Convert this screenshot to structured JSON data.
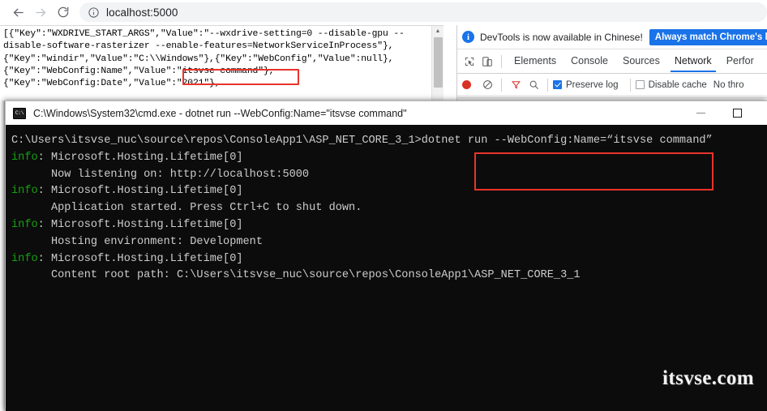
{
  "browser": {
    "toolbar": {
      "back_icon": "back-arrow-icon",
      "forward_icon": "forward-arrow-icon",
      "reload_icon": "reload-icon",
      "site_info_icon": "info-circle-icon",
      "url": "localhost:5000"
    },
    "page": {
      "lines": [
        "[{\"Key\":\"WXDRIVE_START_ARGS\",\"Value\":\"--wxdrive-setting=0 --disable-gpu --",
        "disable-software-rasterizer --enable-features=NetworkServiceInProcess\"},",
        "{\"Key\":\"windir\",\"Value\":\"C:\\\\Windows\"},{\"Key\":\"WebConfig\",\"Value\":null},",
        "{\"Key\":\"WebConfig:Name\",\"Value\":\"itsvse command\"},",
        "{\"Key\":\"WebConfig:Date\",\"Value\":\"2021\"},"
      ],
      "scrollbar": {
        "up_arrow_icon": "scroll-up-arrow-icon",
        "thumb": "scrollbar-thumb"
      }
    }
  },
  "devtools": {
    "banner": {
      "info_icon": "info-badge-icon",
      "info_glyph": "i",
      "message": "DevTools is now available in Chinese!",
      "action_label": "Always match Chrome's lang"
    },
    "tabbar": {
      "inspect_icon": "inspect-element-icon",
      "device_toggle_icon": "device-toolbar-icon",
      "tabs": [
        {
          "label": "Elements",
          "active": false
        },
        {
          "label": "Console",
          "active": false
        },
        {
          "label": "Sources",
          "active": false
        },
        {
          "label": "Network",
          "active": true
        },
        {
          "label": "Perfor",
          "active": false
        }
      ]
    },
    "toolbar": {
      "record_icon": "record-button-icon",
      "clear_icon": "clear-network-log-icon",
      "filter_icon": "filter-funnel-icon",
      "search_icon": "search-magnifier-icon",
      "preserve_log_label": "Preserve log",
      "preserve_log_checked": true,
      "disable_cache_label": "Disable cache",
      "disable_cache_checked": false,
      "throttling_label": "No thro"
    }
  },
  "cmd_window": {
    "icon_name": "cmd-console-icon",
    "icon_glyph": "C:\\",
    "title": "C:\\Windows\\System32\\cmd.exe - dotnet  run --WebConfig:Name=\"itsvse command\"",
    "minimize_label": "minimize-button",
    "maximize_label": "maximize-button",
    "console": {
      "lines": [
        [
          {
            "t": "C:\\Users\\itsvse_nuc\\source\\repos\\ConsoleApp1\\ASP_NET_CORE_3_1>dotnet run --WebConfig:Name=“itsvse command”",
            "c": "white"
          }
        ],
        [
          {
            "t": "info",
            "c": "info"
          },
          {
            "t": ": Microsoft.Hosting.Lifetime[0]",
            "c": "white"
          }
        ],
        [
          {
            "t": "      Now listening on: http://localhost:5000",
            "c": "white"
          }
        ],
        [
          {
            "t": "info",
            "c": "info"
          },
          {
            "t": ": Microsoft.Hosting.Lifetime[0]",
            "c": "white"
          }
        ],
        [
          {
            "t": "      Application started. Press Ctrl+C to shut down.",
            "c": "white"
          }
        ],
        [
          {
            "t": "info",
            "c": "info"
          },
          {
            "t": ": Microsoft.Hosting.Lifetime[0]",
            "c": "white"
          }
        ],
        [
          {
            "t": "      Hosting environment: Development",
            "c": "white"
          }
        ],
        [
          {
            "t": "info",
            "c": "info"
          },
          {
            "t": ": Microsoft.Hosting.Lifetime[0]",
            "c": "white"
          }
        ],
        [
          {
            "t": "      Content root path: C:\\Users\\itsvse_nuc\\source\\repos\\ConsoleApp1\\ASP_NET_CORE_3_1",
            "c": "white"
          }
        ]
      ]
    }
  },
  "annotations": {
    "json_highlight": "itsvse command",
    "console_highlight": "--WebConfig:Name=“itsvse command”",
    "color": "#e8342b"
  },
  "watermark": {
    "text": "itsvse.com"
  }
}
